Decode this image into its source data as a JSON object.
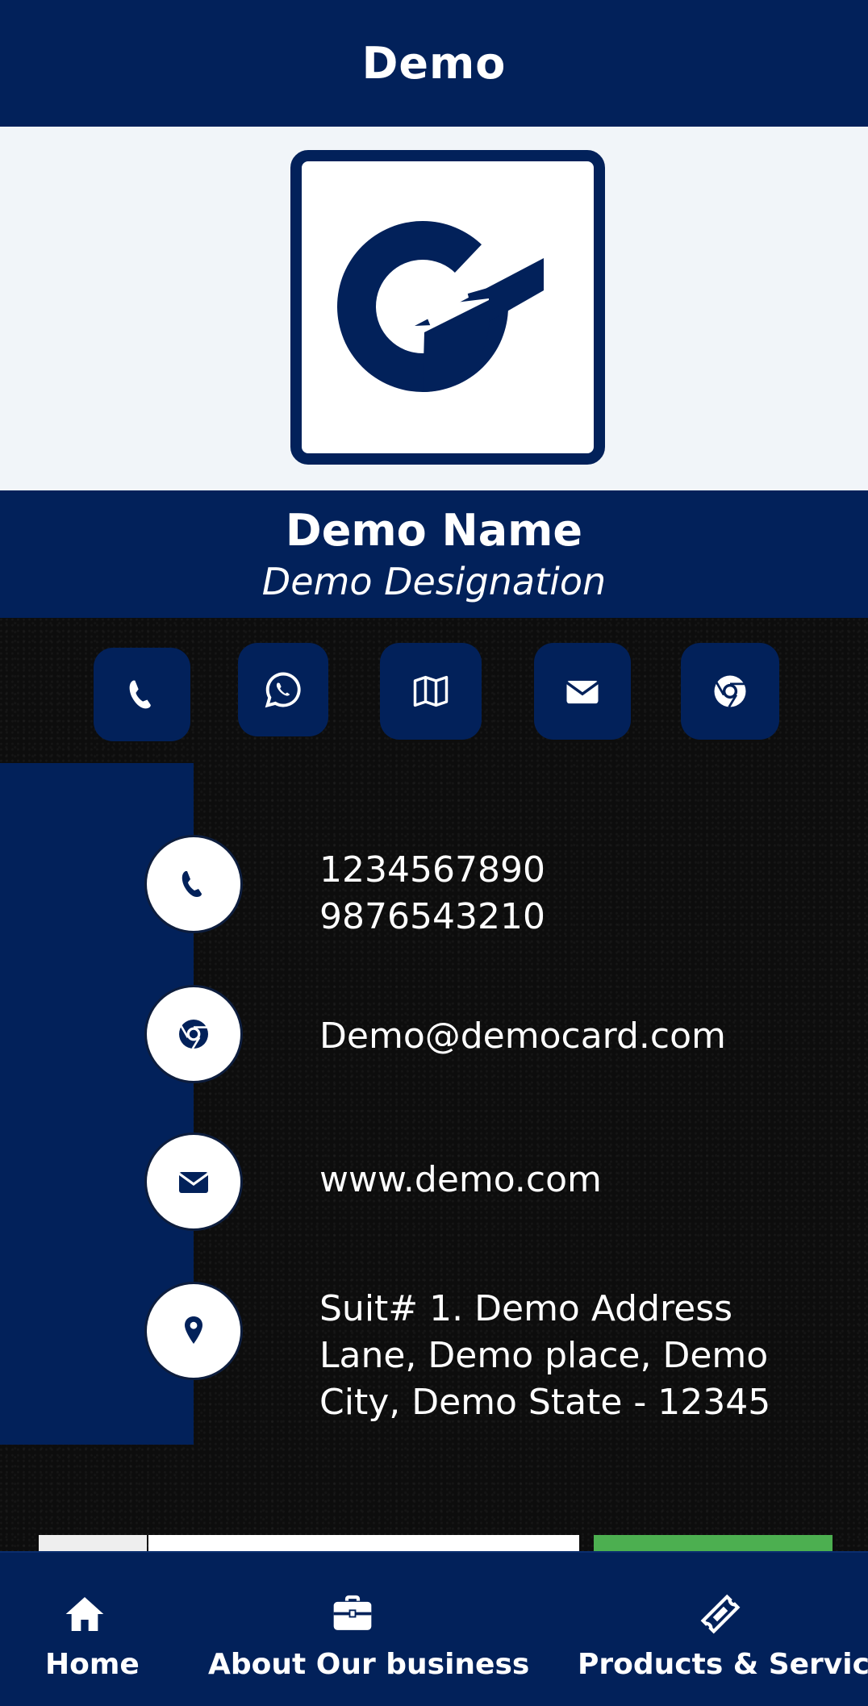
{
  "header": {
    "title": "Demo"
  },
  "profile": {
    "name": "Demo Name",
    "designation": "Demo Designation"
  },
  "quick_actions": [
    {
      "icon": "phone-icon"
    },
    {
      "icon": "whatsapp-icon"
    },
    {
      "icon": "map-icon"
    },
    {
      "icon": "envelope-icon"
    },
    {
      "icon": "chrome-icon"
    }
  ],
  "contact": {
    "phones": [
      "1234567890",
      "9876543210"
    ],
    "email": "Demo@democard.com",
    "website": "www.demo.com",
    "address": "Suit# 1. Demo Address Lane, Demo place, Demo City, Demo State - 12345"
  },
  "bottom_nav": [
    {
      "label": "Home",
      "icon": "home-icon"
    },
    {
      "label": "About Our business",
      "icon": "briefcase-icon"
    },
    {
      "label": "Products & Services",
      "icon": "ticket-icon"
    }
  ],
  "colors": {
    "brand_navy": "#02215a",
    "logo_band": "#f1f5f9",
    "background": "#0d0d0d",
    "submit_green": "#4caf50"
  }
}
